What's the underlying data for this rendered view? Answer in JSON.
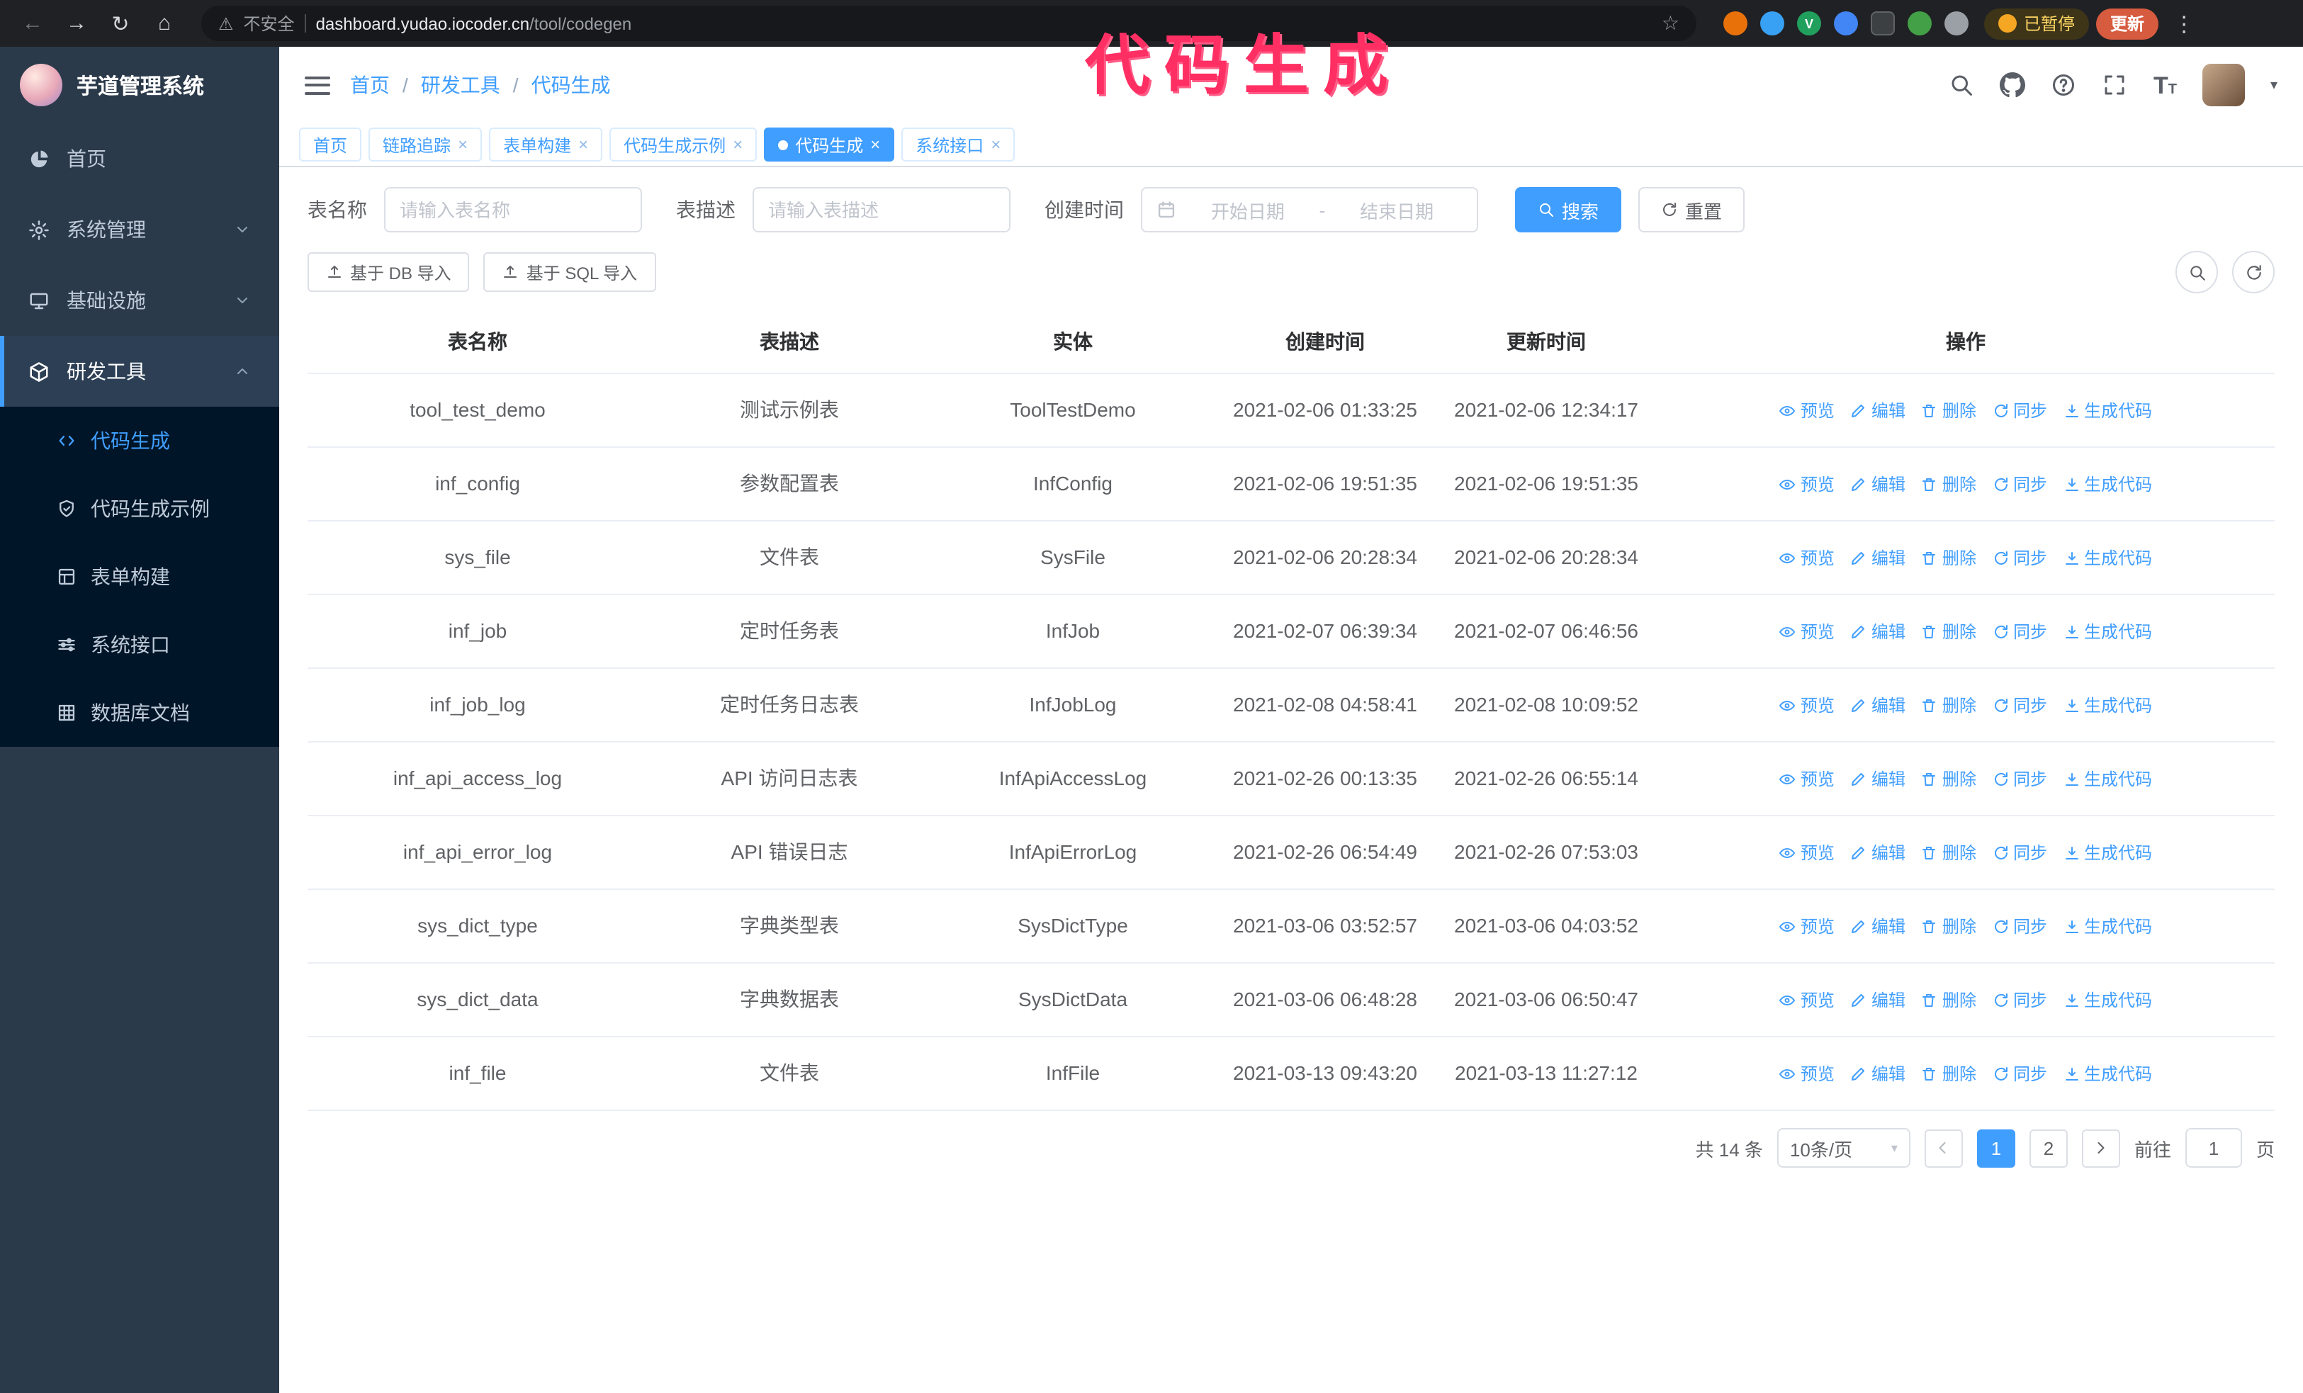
{
  "annotation": {
    "text": "代码生成"
  },
  "browser": {
    "security_label": "不安全",
    "url_host": "dashboard.yudao.iocoder.cn",
    "url_path": "/tool/codegen",
    "paused_badge": "已暂停",
    "update_label": "更新"
  },
  "icons": {
    "back": "←",
    "forward": "→",
    "reload": "↻",
    "home": "⌂",
    "warning": "⚠",
    "star": "☆",
    "ellipsis": "⋮",
    "close": "×",
    "caret": "▾",
    "font_size_big": "T",
    "font_size_small": "T",
    "ext_v_label": "V"
  },
  "colors": {
    "primary": "#409eff",
    "annotation_pink": "#ff2e63",
    "sidebar_bg": "#2b3a4a",
    "submenu_bg": "#001528",
    "active_tab_bg": "#409eff"
  },
  "sidebar": {
    "logo_title": "芋道管理系统",
    "items": [
      {
        "label": "首页"
      },
      {
        "label": "系统管理"
      },
      {
        "label": "基础设施"
      },
      {
        "label": "研发工具"
      }
    ],
    "sub_items": [
      {
        "label": "代码生成"
      },
      {
        "label": "代码生成示例"
      },
      {
        "label": "表单构建"
      },
      {
        "label": "系统接口"
      },
      {
        "label": "数据库文档"
      }
    ]
  },
  "header": {
    "breadcrumb": {
      "items": [
        "首页",
        "研发工具",
        "代码生成"
      ],
      "separator": "/"
    }
  },
  "tabs": [
    {
      "label": "首页"
    },
    {
      "label": "链路追踪"
    },
    {
      "label": "表单构建"
    },
    {
      "label": "代码生成示例"
    },
    {
      "label": "代码生成"
    },
    {
      "label": "系统接口"
    }
  ],
  "filters": {
    "name_label": "表名称",
    "name_placeholder": "请输入表名称",
    "desc_label": "表描述",
    "desc_placeholder": "请输入表描述",
    "time_label": "创建时间",
    "start_placeholder": "开始日期",
    "range_separator": "-",
    "end_placeholder": "结束日期",
    "search_label": "搜索",
    "reset_label": "重置"
  },
  "toolbar": {
    "import_db_label": "基于 DB 导入",
    "import_sql_label": "基于 SQL 导入"
  },
  "table": {
    "columns": [
      "表名称",
      "表描述",
      "实体",
      "创建时间",
      "更新时间",
      "操作"
    ],
    "actions": [
      "预览",
      "编辑",
      "删除",
      "同步",
      "生成代码"
    ],
    "rows": [
      {
        "name": "tool_test_demo",
        "desc": "测试示例表",
        "entity": "ToolTestDemo",
        "created": "2021-02-06 01:33:25",
        "updated": "2021-02-06 12:34:17"
      },
      {
        "name": "inf_config",
        "desc": "参数配置表",
        "entity": "InfConfig",
        "created": "2021-02-06 19:51:35",
        "updated": "2021-02-06 19:51:35"
      },
      {
        "name": "sys_file",
        "desc": "文件表",
        "entity": "SysFile",
        "created": "2021-02-06 20:28:34",
        "updated": "2021-02-06 20:28:34"
      },
      {
        "name": "inf_job",
        "desc": "定时任务表",
        "entity": "InfJob",
        "created": "2021-02-07 06:39:34",
        "updated": "2021-02-07 06:46:56"
      },
      {
        "name": "inf_job_log",
        "desc": "定时任务日志表",
        "entity": "InfJobLog",
        "created": "2021-02-08 04:58:41",
        "updated": "2021-02-08 10:09:52"
      },
      {
        "name": "inf_api_access_log",
        "desc": "API 访问日志表",
        "entity": "InfApiAccessLog",
        "created": "2021-02-26 00:13:35",
        "updated": "2021-02-26 06:55:14"
      },
      {
        "name": "inf_api_error_log",
        "desc": "API 错误日志",
        "entity": "InfApiErrorLog",
        "created": "2021-02-26 06:54:49",
        "updated": "2021-02-26 07:53:03"
      },
      {
        "name": "sys_dict_type",
        "desc": "字典类型表",
        "entity": "SysDictType",
        "created": "2021-03-06 03:52:57",
        "updated": "2021-03-06 04:03:52"
      },
      {
        "name": "sys_dict_data",
        "desc": "字典数据表",
        "entity": "SysDictData",
        "created": "2021-03-06 06:48:28",
        "updated": "2021-03-06 06:50:47"
      },
      {
        "name": "inf_file",
        "desc": "文件表",
        "entity": "InfFile",
        "created": "2021-03-13 09:43:20",
        "updated": "2021-03-13 11:27:12"
      }
    ]
  },
  "pagination": {
    "total_label": "共 14 条",
    "page_size_label": "10条/页",
    "pages": [
      "1",
      "2"
    ],
    "goto_label": "前往",
    "goto_value": "1",
    "goto_suffix": "页"
  }
}
